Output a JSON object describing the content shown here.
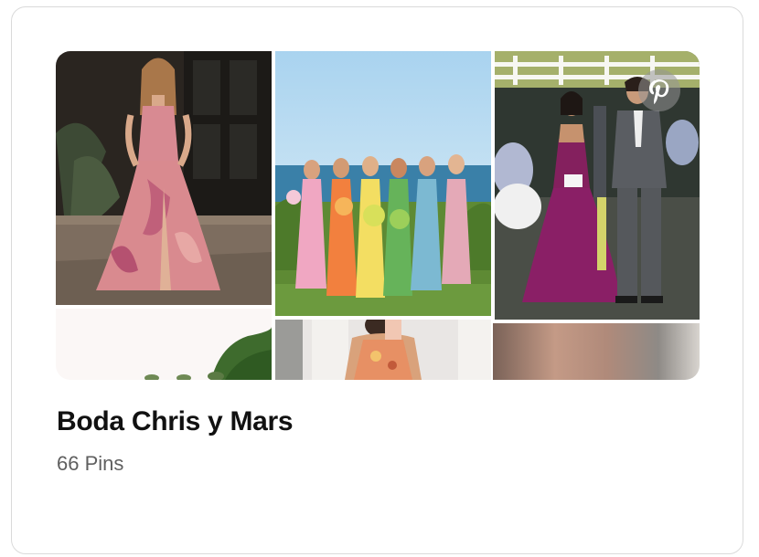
{
  "board": {
    "title": "Boda Chris y Mars",
    "pin_count_label": "66 Pins"
  },
  "images": [
    {
      "name": "floral-gown-photo",
      "alt": "Woman in pink floral strapless gown"
    },
    {
      "name": "garden-photo",
      "alt": "Garden with trees"
    },
    {
      "name": "bridesmaids-beach-photo",
      "alt": "Bridesmaids in colorful dresses by the sea"
    },
    {
      "name": "orange-dress-selfie-photo",
      "alt": "Woman in orange floral dress taking selfie"
    },
    {
      "name": "wedding-walk-photo",
      "alt": "Couple in purple gown and grey suit walking"
    },
    {
      "name": "blurred-photo",
      "alt": "Blurred image"
    }
  ],
  "icons": {
    "pinterest_badge": "pinterest-icon"
  },
  "colors": {
    "title": "#111111",
    "meta": "#5f5f5f",
    "border": "#dadada"
  }
}
